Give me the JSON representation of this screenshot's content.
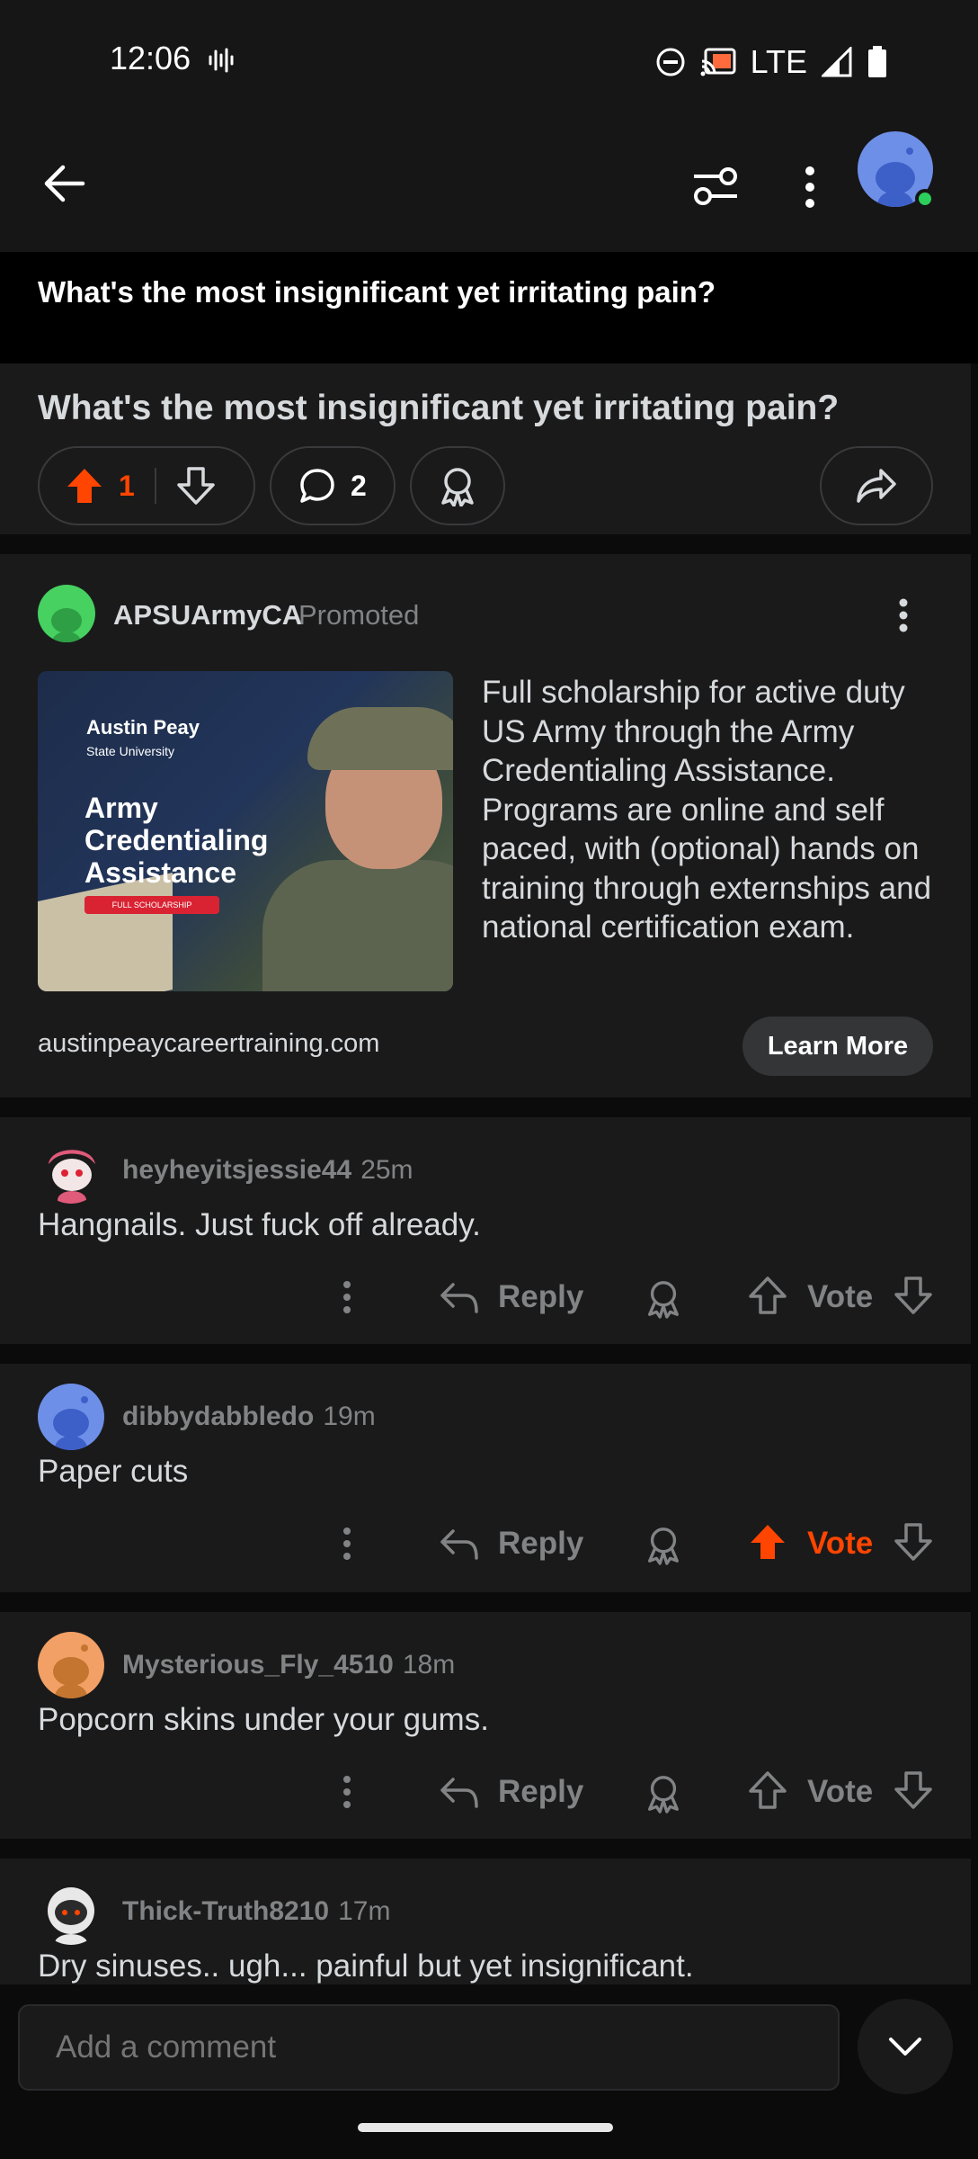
{
  "status_bar": {
    "time": "12:06",
    "network": "LTE"
  },
  "thread": {
    "sticky_title": "What's the most insignificant yet irritating pain?",
    "title": "What's the most insignificant yet irritating pain?",
    "upvotes": "1",
    "comments": "2"
  },
  "ad": {
    "advertiser": "APSUArmyCA",
    "promoted_label": "Promoted",
    "image_brand_line1": "Austin Peay",
    "image_brand_line2": "State University",
    "image_title": "Army Credentialing Assistance",
    "image_badge": "FULL SCHOLARSHIP",
    "description": "Full scholarship for active duty US Army through the Army Credentialing Assistance. Programs are online and self paced, with (optional) hands on training through externships and national certification exam.",
    "domain": "austinpeaycareertraining.com",
    "cta": "Learn More"
  },
  "comments": [
    {
      "user": "heyheyitsjessie44",
      "age": "25m",
      "body": "Hangnails.  Just fuck off already.",
      "reply_label": "Reply",
      "vote_label": "Vote",
      "upvoted": false
    },
    {
      "user": "dibbydabbledo",
      "age": "19m",
      "body": "Paper cuts",
      "reply_label": "Reply",
      "vote_label": "Vote",
      "upvoted": true
    },
    {
      "user": "Mysterious_Fly_4510",
      "age": "18m",
      "body": "Popcorn skins under your gums.",
      "reply_label": "Reply",
      "vote_label": "Vote",
      "upvoted": false
    },
    {
      "user": "Thick-Truth8210",
      "age": "17m",
      "body": "Dry sinuses.. ugh... painful but yet insignificant."
    }
  ],
  "composer": {
    "placeholder": "Add a comment"
  },
  "colors": {
    "accent": "#ff4500",
    "online": "#2ccf5b"
  }
}
